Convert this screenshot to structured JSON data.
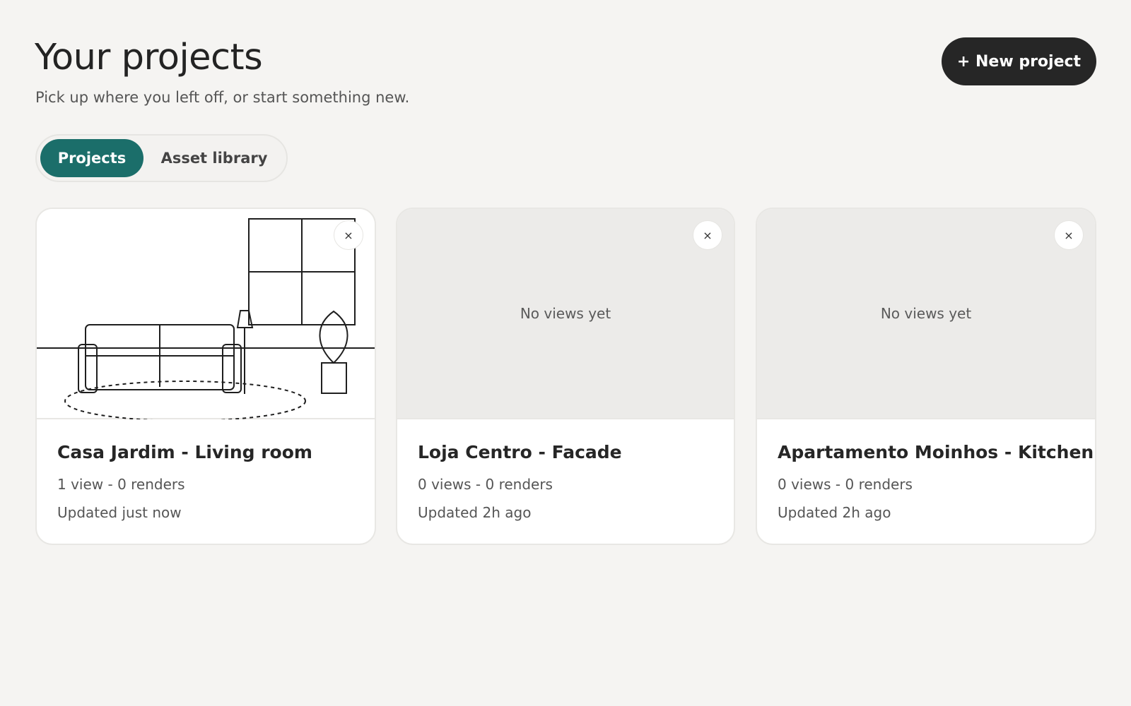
{
  "header": {
    "title": "Your projects",
    "subtitle": "Pick up where you left off, or start something new.",
    "new_project_label": "+ New project"
  },
  "tabs": [
    {
      "label": "Projects",
      "active": true
    },
    {
      "label": "Asset library",
      "active": false
    }
  ],
  "projects": [
    {
      "title": "Casa Jardim - Living room",
      "meta": "1 view - 0 renders",
      "updated": "Updated just now",
      "preview": "living-room-sketch",
      "close_label": "×"
    },
    {
      "title": "Loja Centro - Facade",
      "meta": "0 views - 0 renders",
      "updated": "Updated 2h ago",
      "preview_empty_label": "No views yet",
      "close_label": "×"
    },
    {
      "title": "Apartamento Moinhos - Kitchen",
      "meta": "0 views - 0 renders",
      "updated": "Updated 2h ago",
      "preview_empty_label": "No views yet",
      "close_label": "×"
    }
  ],
  "colors": {
    "background": "#f5f4f2",
    "accent": "#1b6e6a",
    "primary_button": "#262626",
    "card_border": "#e8e7e4",
    "empty_preview": "#ecebe9"
  }
}
